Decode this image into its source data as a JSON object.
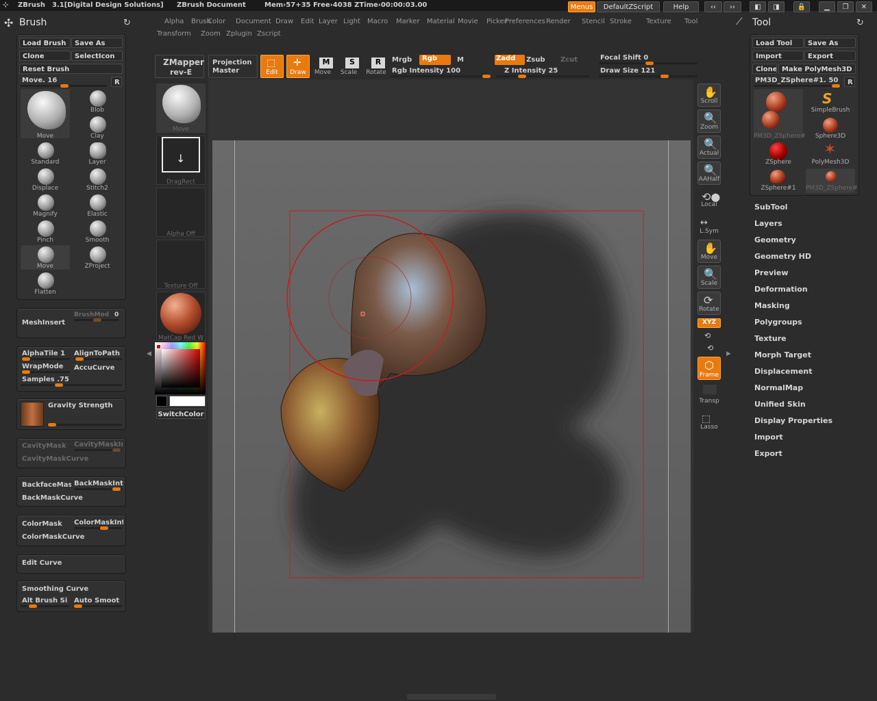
{
  "topbar": {
    "app": "ZBrush",
    "version": "3.1[Digital Design Solutions]",
    "document": "ZBrush Document",
    "mem": "Mem›57+35 Free›4038 ZTime›00:00:03.00",
    "menus": "Menus",
    "script": "DefaultZScript",
    "help": "Help"
  },
  "menus": {
    "row1": [
      "Alpha",
      "Brush",
      "Color",
      "Document",
      "Draw",
      "Edit",
      "Layer",
      "Light",
      "Macro",
      "Marker",
      "Material",
      "Movie",
      "Picker",
      "Preferences",
      "Render",
      "Stencil",
      "Stroke",
      "Texture",
      "Tool"
    ],
    "row2": [
      "Transform",
      "Zoom",
      "Zplugin",
      "Zscript"
    ]
  },
  "brush": {
    "title": "Brush",
    "load": "Load Brush",
    "save": "Save As",
    "clone": "Clone",
    "select_icon": "SelectIcon",
    "reset": "Reset Brush",
    "move_value": "Move. 16",
    "r": "R",
    "items": [
      "Move",
      "Blob",
      "Clay",
      "Standard",
      "Layer",
      "Displace",
      "Stitch2",
      "Magnify",
      "Elastic",
      "Pinch",
      "Smooth",
      "Move",
      "ZProject",
      "Flatten"
    ],
    "meshinsert": "MeshInsert",
    "brushmod": "BrushMod",
    "brushmod_val": "0",
    "alphatile": "AlphaTile 1",
    "aligntopath": "AlignToPath",
    "wrapmode": "WrapMode",
    "accucurve": "AccuCurve",
    "samples": "Samples .75",
    "gravity": "Gravity Strength",
    "cavitymask": "CavityMask",
    "cavitymaskint": "CavityMaskInt",
    "cavitymaskcurve": "CavityMaskCurve",
    "backfacemask": "BackfaceMask",
    "backmaskint": "BackMaskInt",
    "backmaskcurve": "BackMaskCurve",
    "colormask": "ColorMask",
    "colormaskint": "ColorMaskInt",
    "colormaskcurve": "ColorMaskCurve",
    "editcurve": "Edit Curve",
    "smoothingcurve": "Smoothing Curve",
    "altbrush": "Alt Brush Si",
    "autosmooth": "Auto Smoot"
  },
  "shelf": {
    "zmapper": "ZMapper",
    "rev": "rev-E",
    "projection": "Projection",
    "master": "Master",
    "move": "Move",
    "dragrect": "DragRect",
    "alpha": "Alpha Off",
    "texture": "Texture Off",
    "matcap": "MatCap Red W",
    "switchcolor": "SwitchColor"
  },
  "toolbar": {
    "edit": "Edit",
    "draw": "Draw",
    "move": "Move",
    "scale": "Scale",
    "rotate": "Rotate",
    "mrgb": "Mrgb",
    "rgb": "Rgb",
    "m": "M",
    "rgb_intensity": "Rgb Intensity 100",
    "zadd": "Zadd",
    "zsub": "Zsub",
    "zcut": "Zcut",
    "z_intensity": "Z Intensity 25",
    "focal": "Focal Shift 0",
    "drawsize": "Draw Size 121"
  },
  "right_tools": {
    "scroll": "Scroll",
    "zoom": "Zoom",
    "actual": "Actual",
    "aahalf": "AAHalf",
    "local": "Local",
    "lsym": "L.Sym",
    "move": "Move",
    "scale": "Scale",
    "rotate": "Rotate",
    "xyz": "XYZ",
    "frame": "Frame",
    "transp": "Transp",
    "lasso": "Lasso"
  },
  "tool": {
    "title": "Tool",
    "load": "Load Tool",
    "save": "Save As",
    "import": "Import",
    "export": "Export",
    "clone": "Clone",
    "make": "Make PolyMesh3D",
    "current": "PM3D_ZSphere#1. 50",
    "r": "R",
    "items": [
      "PM3D_ZSphere#",
      "SimpleBrush",
      "Sphere3D",
      "ZSphere",
      "PolyMesh3D",
      "ZSphere#1",
      "PM3D_ZSphere#"
    ],
    "sections": [
      "SubTool",
      "Layers",
      "Geometry",
      "Geometry HD",
      "Preview",
      "Deformation",
      "Masking",
      "Polygroups",
      "Texture",
      "Morph Target",
      "Displacement",
      "NormalMap",
      "Unified Skin",
      "Display Properties",
      "Import",
      "Export"
    ]
  },
  "colors": {
    "accent": "#e87a10",
    "panel": "#313131",
    "bg": "#2c2c2c"
  }
}
